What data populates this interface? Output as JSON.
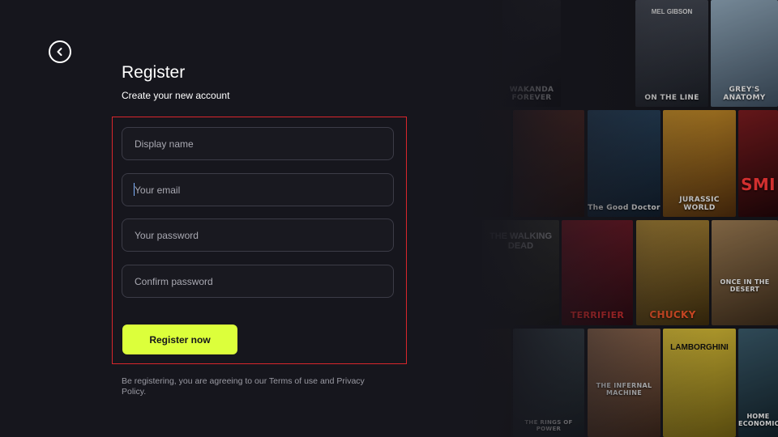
{
  "header": {
    "back_icon": "chevron-left-icon",
    "title": "Register",
    "subtitle": "Create your new account"
  },
  "form": {
    "display_name": {
      "placeholder": "Display name",
      "value": ""
    },
    "email": {
      "placeholder": "Your email",
      "value": ""
    },
    "password": {
      "placeholder": "Your password",
      "value": ""
    },
    "confirm_password": {
      "placeholder": "Confirm password",
      "value": ""
    },
    "submit_label": "Register now"
  },
  "terms_text": "Be registering, you are agreeing to our Terms of use and Privacy Policy.",
  "colors": {
    "background": "#16161d",
    "accent": "#dcff3b",
    "highlight_border": "#d9262c",
    "field_border": "#3c3c47"
  },
  "posters": [
    {
      "title": "WAKANDA FOREVER",
      "top_text": "",
      "colors": [
        "#2a2a30",
        "#0d0d12"
      ]
    },
    {
      "title": "ON THE LINE",
      "top_text": "MEL GIBSON",
      "colors": [
        "#4a4f5a",
        "#1a1d24"
      ]
    },
    {
      "title": "GREY'S ANATOMY",
      "top_text": "",
      "colors": [
        "#8fa6b8",
        "#3c4c5c"
      ]
    },
    {
      "title": "",
      "top_text": "",
      "colors": [
        "#3a2418",
        "#140c08"
      ]
    },
    {
      "title": "",
      "top_text": "",
      "colors": [
        "#6a3228",
        "#1f0f0c"
      ]
    },
    {
      "title": "The Good Doctor",
      "top_text": "",
      "colors": [
        "#2c4a66",
        "#0f1c2a"
      ]
    },
    {
      "title": "JURASSIC WORLD",
      "top_text": "",
      "colors": [
        "#c9902a",
        "#4a2a0c"
      ]
    },
    {
      "title": "SMI",
      "top_text": "",
      "colors": [
        "#7a1c20",
        "#200608"
      ]
    },
    {
      "title": "THE WALKING DEAD",
      "top_text": "",
      "colors": [
        "#4a4a40",
        "#151510"
      ]
    },
    {
      "title": "TERRIFIER",
      "top_text": "",
      "colors": [
        "#8a1c2a",
        "#2a050c"
      ]
    },
    {
      "title": "CHUCKY",
      "top_text": "",
      "colors": [
        "#b08a38",
        "#3a2a0c"
      ]
    },
    {
      "title": "ONCE IN THE DESERT",
      "top_text": "",
      "colors": [
        "#9a7a52",
        "#3a2a1a"
      ]
    },
    {
      "title": "",
      "top_text": "",
      "colors": [
        "#3a3020",
        "#120e08"
      ]
    },
    {
      "title": "THE RINGS OF POWER",
      "top_text": "",
      "colors": [
        "#4a5a62",
        "#141c20"
      ]
    },
    {
      "title": "THE INFERNAL MACHINE",
      "top_text": "",
      "colors": [
        "#a87a5a",
        "#3a2418"
      ]
    },
    {
      "title": "LAMBORGHINI",
      "top_text": "",
      "colors": [
        "#e0c43a",
        "#6a5a12"
      ]
    },
    {
      "title": "HOME ECONOMICS",
      "top_text": "",
      "colors": [
        "#3a5a6a",
        "#122028"
      ]
    }
  ]
}
